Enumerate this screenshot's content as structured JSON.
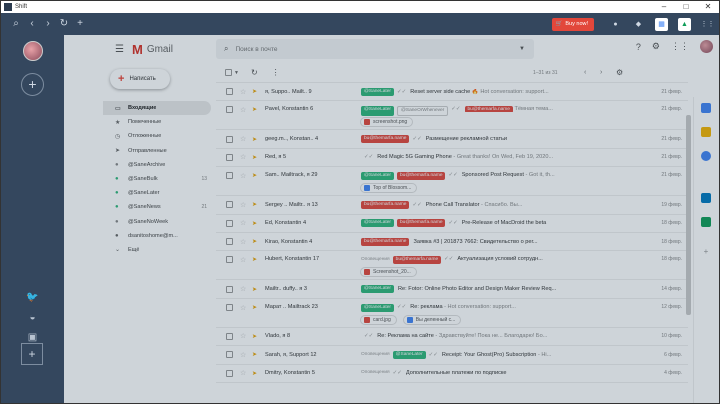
{
  "window": {
    "title": "Shift"
  },
  "toolbar": {
    "buy_label": "Buy now!"
  },
  "gmail": {
    "logo": "Gmail",
    "search_placeholder": "Поиск в почте"
  },
  "compose_label": "Написать",
  "nav": [
    {
      "icon": "inbox-icon",
      "label": "Входящие",
      "count": "",
      "active": true,
      "color": ""
    },
    {
      "icon": "star-icon",
      "label": "Помеченные",
      "count": "",
      "active": false,
      "color": ""
    },
    {
      "icon": "clock-icon",
      "label": "Отложенные",
      "count": "",
      "active": false,
      "color": ""
    },
    {
      "icon": "send-icon",
      "label": "Отправленные",
      "count": "",
      "active": false,
      "color": ""
    },
    {
      "icon": "label-icon",
      "label": "@SaneArchive",
      "count": "",
      "active": false,
      "color": "#888"
    },
    {
      "icon": "label-icon",
      "label": "@SaneBulk",
      "count": "13",
      "active": false,
      "color": "#2fb67a"
    },
    {
      "icon": "label-icon",
      "label": "@SaneLater",
      "count": "",
      "active": false,
      "color": "#2fb67a"
    },
    {
      "icon": "label-icon",
      "label": "@SaneNews",
      "count": "21",
      "active": false,
      "color": "#2fb67a"
    },
    {
      "icon": "label-icon",
      "label": "@SaneNoWeek",
      "count": "",
      "active": false,
      "color": "#888"
    },
    {
      "icon": "label-icon",
      "label": "dsanitoshome@m...",
      "count": "",
      "active": false,
      "color": "#666"
    },
    {
      "icon": "chevron-down-icon",
      "label": "Ещё",
      "count": "",
      "active": false,
      "color": ""
    }
  ],
  "list_toolbar": {
    "count": "1–31 из 31"
  },
  "emails": [
    {
      "sender": "я, Suppo.. Mailt.. 9",
      "labels": [
        {
          "t": "@SaneLater",
          "c": "green"
        }
      ],
      "checks": "✓✓",
      "subject": "Reset server side cache",
      "snippet": " 🔥 Hot conversation: support...",
      "date": "21 февр.",
      "attach": []
    },
    {
      "sender": "Pavel, Konstantin 6",
      "labels": [
        {
          "t": "@SaneLater",
          "c": "green"
        },
        {
          "t": "@SaneOrWhenever",
          "c": "gray"
        }
      ],
      "checks": "✓✓",
      "subject": "bu@themarfa.name",
      "snippet": " Тёмная тема...",
      "date": "21 февр.",
      "attach": [
        {
          "n": "screenshot.png",
          "c": "#e2473b"
        }
      ]
    },
    {
      "sender": "geeg.m.., Konstan.. 4",
      "labels": [
        {
          "t": "bu@themarfa.name",
          "c": "red"
        }
      ],
      "checks": "✓✓",
      "subject": "Размещение рекламной статьи",
      "snippet": "",
      "date": "21 февр.",
      "attach": []
    },
    {
      "sender": "Red, я 5",
      "labels": [],
      "checks": "✓✓",
      "subject": "Red Magic 5G Gaming Phone",
      "snippet": " - Great thanks! On Wed, Feb 19, 2020...",
      "date": "21 февр.",
      "attach": []
    },
    {
      "sender": "Sam.. Mailtrack, я 29",
      "labels": [
        {
          "t": "@SaneLater",
          "c": "green"
        },
        {
          "t": "bu@themarfa.name",
          "c": "red"
        }
      ],
      "checks": "✓✓",
      "subject": "Sponsored Post Request",
      "snippet": " - Got it, th...",
      "date": "21 февр.",
      "attach": [
        {
          "n": "Top of Blossom...",
          "c": "#4285f4"
        }
      ]
    },
    {
      "sender": "Sergey .. Mailtr.. я 13",
      "labels": [
        {
          "t": "bu@themarfa.name",
          "c": "red"
        }
      ],
      "checks": "✓✓",
      "subject": "Phone Call Translator",
      "snippet": " - Спасибо. Вы...",
      "date": "19 февр.",
      "attach": []
    },
    {
      "sender": "Ed, Konstantin 4",
      "labels": [
        {
          "t": "@SaneLater",
          "c": "green"
        },
        {
          "t": "bu@themarfa.name",
          "c": "red"
        }
      ],
      "checks": "✓✓",
      "subject": "Pre-Release of MacDroid the beta",
      "snippet": "",
      "date": "18 февр.",
      "attach": []
    },
    {
      "sender": "Kirao, Konstantin 4",
      "labels": [
        {
          "t": "bu@themarfa.name",
          "c": "red"
        }
      ],
      "checks": "",
      "subject": "Заявка #3 | 201873 7662: Свидетельство о рег...",
      "snippet": "",
      "date": "18 февр.",
      "attach": []
    },
    {
      "sender": "Hubert, Konstantin 17",
      "labels": [
        {
          "t": "Оповещения",
          "c": "plain"
        },
        {
          "t": "bu@themarfa.name",
          "c": "red"
        }
      ],
      "checks": "✓✓",
      "subject": "Актуализация условий сотрудн...",
      "snippet": "",
      "date": "18 февр.",
      "attach": [
        {
          "n": "Screenshot_20...",
          "c": "#e2473b"
        }
      ]
    },
    {
      "sender": "Mailtr.. duffy.. я 3",
      "labels": [
        {
          "t": "@SaneLater",
          "c": "green"
        }
      ],
      "checks": "",
      "subject": "Re: Fotor: Online Photo Editor and Design Maker Review Req...",
      "snippet": "",
      "date": "14 февр.",
      "attach": []
    },
    {
      "sender": "Марат .. Mailtrack 23",
      "labels": [
        {
          "t": "@SaneLater",
          "c": "green"
        }
      ],
      "checks": "✓✓",
      "subject": "Re: реклама",
      "snippet": " - Hot conversation: support...",
      "date": "12 февр.",
      "attach": [
        {
          "n": "card.jpg",
          "c": "#e2473b"
        },
        {
          "n": "Вы деленный с...",
          "c": "#4285f4"
        }
      ]
    },
    {
      "sender": "Vlado, я 8",
      "labels": [],
      "checks": "✓✓",
      "subject": "Re: Реклама на сайте",
      "snippet": " - Здравствуйте! Пока не... Благодарю! Бо...",
      "date": "10 февр.",
      "attach": []
    },
    {
      "sender": "Sarah, я, Support 12",
      "labels": [
        {
          "t": "Оповещения",
          "c": "plain"
        },
        {
          "t": "@SaneLater",
          "c": "green"
        }
      ],
      "checks": "✓✓",
      "subject": "Receipt: Your Ghost(Pro) Subscription",
      "snippet": " - Hi...",
      "date": "6 февр.",
      "attach": []
    },
    {
      "sender": "Dmitry, Konstantin 5",
      "labels": [
        {
          "t": "Оповещения",
          "c": "plain"
        }
      ],
      "checks": "✓✓",
      "subject": "Дополнительные платежи по подписке",
      "snippet": "",
      "date": "4 февр.",
      "attach": []
    }
  ],
  "colors": {
    "shell": "#34475e",
    "accent": "#e2473b",
    "label_green": "#2fb67a"
  }
}
